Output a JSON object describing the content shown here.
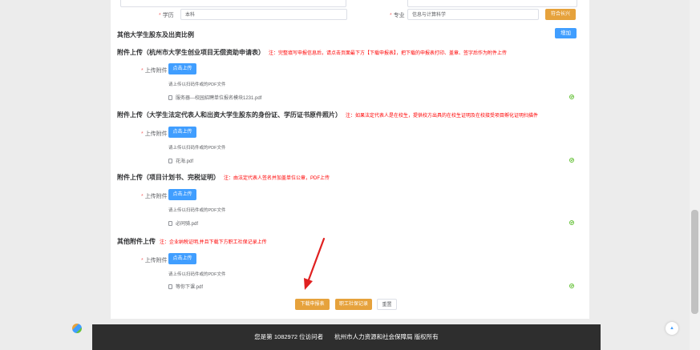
{
  "form": {
    "education_label": "学历",
    "education_value": "本科",
    "major_label": "专业",
    "major_value": "信息与计算科学",
    "major_button": "符合长兴",
    "shareholders_title": "其他大学生股东及出资比例",
    "add_button": "增加"
  },
  "sections": [
    {
      "title": "附件上传（杭州市大学生创业项目无偿资助申请表）",
      "note": "注：完整填写申报信息后，请点击页面最下方【下载申报表】，把下载的申报表打印、盖章、签字后作为附件上传",
      "upload_label": "上传附件",
      "upload_button": "点击上传",
      "tip": "请上传以扫码件或的PDF文件",
      "file": "服务器---校园招聘单位报名模块1231.pdf"
    },
    {
      "title": "附件上传（大学生法定代表人和出资大学生股东的身份证、学历证书原件照片）",
      "note": "注：如果法定代表人是在校生，提供校方出具的在校生证明及在校接受项目孵化证明扫描件",
      "upload_label": "上传附件",
      "upload_button": "点击上传",
      "tip": "请上传以扫码件或的PDF文件",
      "file": "花海.pdf"
    },
    {
      "title": "附件上传（项目计划书、完税证明）",
      "note": "注：由法定代表人签名并加盖单位公章，PDF上传",
      "upload_label": "上传附件",
      "upload_button": "点击上传",
      "tip": "请上传以扫码件或的PDF文件",
      "file": "必同骑.pdf"
    },
    {
      "title": "其他附件上传",
      "note": "注：企业纳税证明,并且下载下方职工社保记录上传",
      "upload_label": "上传附件",
      "upload_button": "点击上传",
      "tip": "请上传以扫码件或的PDF文件",
      "file": "等你下课.pdf"
    }
  ],
  "actions": {
    "download": "下载申报表",
    "social_security": "职工社保记录",
    "reset": "重置"
  },
  "footer": {
    "counter": "您是第 1082972 位访问者",
    "org": "杭州市人力资源和社会保障局 版权所有"
  },
  "colors": {
    "primary": "#409eff",
    "warning": "#e6a23c",
    "success": "#67c23a",
    "danger": "#f00",
    "annotation_arrow": "#e02020"
  }
}
